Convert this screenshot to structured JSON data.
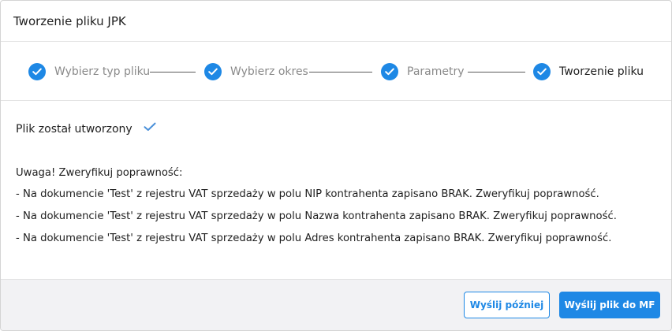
{
  "dialog": {
    "title": "Tworzenie pliku JPK"
  },
  "steps": [
    {
      "label": "Wybierz typ pliku",
      "state": "done"
    },
    {
      "label": "Wybierz okres",
      "state": "done"
    },
    {
      "label": "Parametry",
      "state": "done"
    },
    {
      "label": "Tworzenie pliku",
      "state": "active"
    }
  ],
  "status": {
    "text": "Plik został utworzony",
    "icon": "check-icon"
  },
  "warnings": {
    "heading": "Uwaga! Zweryfikuj poprawność:",
    "items": [
      "- Na dokumencie 'Test' z rejestru VAT sprzedaży w polu NIP kontrahenta zapisano BRAK. Zweryfikuj poprawność.",
      "- Na dokumencie 'Test' z rejestru VAT sprzedaży w polu Nazwa kontrahenta zapisano BRAK. Zweryfikuj poprawność.",
      "- Na dokumencie 'Test' z rejestru VAT sprzedaży w polu Adres kontrahenta zapisano BRAK. Zweryfikuj poprawność."
    ]
  },
  "footer": {
    "send_later_label": "Wyślij później",
    "send_label": "Wyślij plik do MF"
  },
  "colors": {
    "accent": "#1e88e5",
    "footer_bg": "#f2f2f4"
  }
}
